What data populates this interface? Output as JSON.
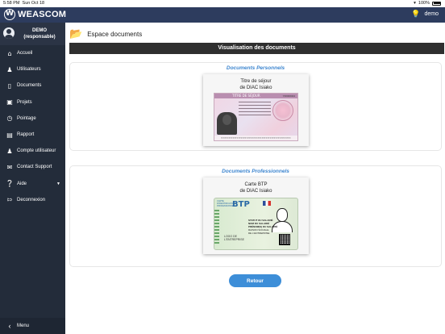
{
  "status_bar": {
    "time": "5:58 PM",
    "date": "Sun Oct 18",
    "battery": "100%"
  },
  "header": {
    "logo_text": "WEASCOM",
    "username": "demo"
  },
  "sidebar": {
    "profile": {
      "name": "DEMO",
      "role": "(responsable)"
    },
    "items": [
      {
        "label": "Accueil",
        "icon": "home-icon",
        "glyph": "⌂"
      },
      {
        "label": "Utilisateurs",
        "icon": "users-icon",
        "glyph": "👥"
      },
      {
        "label": "Documents",
        "icon": "folder-open-icon",
        "glyph": "📂"
      },
      {
        "label": "Projets",
        "icon": "briefcase-icon",
        "glyph": "💼"
      },
      {
        "label": "Pointage",
        "icon": "clock-icon",
        "glyph": "🕓"
      },
      {
        "label": "Rapport",
        "icon": "document-icon",
        "glyph": "🗎"
      },
      {
        "label": "Compte utilisateur",
        "icon": "user-icon",
        "glyph": "👤"
      },
      {
        "label": "Contact Support",
        "icon": "envelope-icon",
        "glyph": "✉"
      },
      {
        "label": "Aide",
        "icon": "question-icon",
        "glyph": "?"
      },
      {
        "label": "Deconnexion",
        "icon": "logout-icon",
        "glyph": "⎋"
      }
    ],
    "menu_label": "Menu"
  },
  "main": {
    "page_title": "Espace documents",
    "section_title": "Visualisation des documents",
    "personal": {
      "legend": "Documents Personnels",
      "card_title_1": "Titre de séjour",
      "card_title_2": "de DIAC Isiako",
      "doc_band": "TITRE DE SÉJOUR",
      "doc_number": "Y00000044",
      "doc_mrz": "<<<<<<<<<<<<<<<<<<<<<<<<<<<<<<<<<<<<"
    },
    "professional": {
      "legend": "Documents Professionnels",
      "card_title_1": "Carte BTP",
      "card_title_2": "de DIAC Isiako",
      "card_label": "CARTE D'IDENTIFICATION PROFESSIONNELLE",
      "logo": "BTP",
      "name_line_1": "NOM DU SALARIÉ",
      "name_line_2": "PRÉNOM(S) DU SALARIÉ",
      "status": "STATUT DU SALARIÉ",
      "company": "RAISON SOCIALE DE L'ENTREPRISE",
      "logo_box": "LOGO DE L'ENTREPRISE"
    },
    "back_button": "Retour"
  },
  "colors": {
    "topbar": "#2d3c5e",
    "sidebar": "#232c3a",
    "accent": "#3d8ed8",
    "legend": "#3e86cf"
  }
}
